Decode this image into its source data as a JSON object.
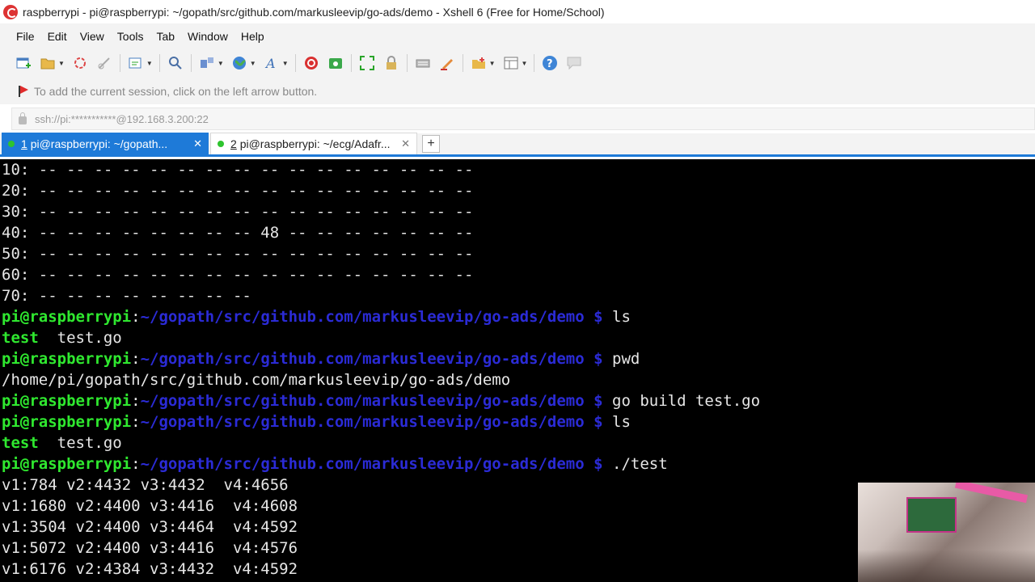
{
  "window": {
    "title": "raspberrypi - pi@raspberrypi: ~/gopath/src/github.com/markusleevip/go-ads/demo - Xshell 6 (Free for Home/School)"
  },
  "menu": [
    "File",
    "Edit",
    "View",
    "Tools",
    "Tab",
    "Window",
    "Help"
  ],
  "toolbar": {
    "icons": [
      "new-session-icon",
      "open-folder-icon",
      "reconnect-icon",
      "disconnect-icon",
      "properties-icon",
      "find-icon",
      "layout-icon",
      "globe-icon",
      "font-icon",
      "xshell-logo-icon",
      "xftp-icon",
      "fullscreen-icon",
      "lock-icon",
      "keyboard-icon",
      "highlighter-icon",
      "compose-icon",
      "layout-panes-icon",
      "help-icon",
      "chat-icon"
    ]
  },
  "session_hint": "To add the current session, click on the left arrow button.",
  "address": "ssh://pi:***********@192.168.3.200:22",
  "tabs": [
    {
      "number": "1",
      "label": "pi@raspberrypi: ~/gopath...",
      "active": true
    },
    {
      "number": "2",
      "label": "pi@raspberrypi: ~/ecg/Adafr...",
      "active": false
    }
  ],
  "terminal": {
    "i2c_rows": [
      "10: -- -- -- -- -- -- -- -- -- -- -- -- -- -- -- --",
      "20: -- -- -- -- -- -- -- -- -- -- -- -- -- -- -- --",
      "30: -- -- -- -- -- -- -- -- -- -- -- -- -- -- -- --",
      "40: -- -- -- -- -- -- -- -- 48 -- -- -- -- -- -- --",
      "50: -- -- -- -- -- -- -- -- -- -- -- -- -- -- -- --",
      "60: -- -- -- -- -- -- -- -- -- -- -- -- -- -- -- --",
      "70: -- -- -- -- -- -- -- --"
    ],
    "prompt_user": "pi@raspberrypi",
    "prompt_colon": ":",
    "prompt_path": "~/gopath/src/github.com/markusleevip/go-ads/demo",
    "prompt_dollar": " $ ",
    "cmd_ls": "ls",
    "ls_exec": "test",
    "ls_file": "  test.go",
    "cmd_pwd": "pwd",
    "pwd_output": "/home/pi/gopath/src/github.com/markusleevip/go-ads/demo",
    "cmd_build": "go build test.go",
    "cmd_ls2": "ls",
    "ls2_exec": "test",
    "ls2_file": "  test.go",
    "cmd_run": "./test",
    "readings": [
      "v1:784 v2:4432 v3:4432  v4:4656",
      "v1:1680 v2:4400 v3:4416  v4:4608",
      "v1:3504 v2:4400 v3:4464  v4:4592",
      "v1:5072 v2:4400 v3:4416  v4:4576",
      "v1:6176 v2:4384 v3:4432  v4:4592"
    ]
  }
}
